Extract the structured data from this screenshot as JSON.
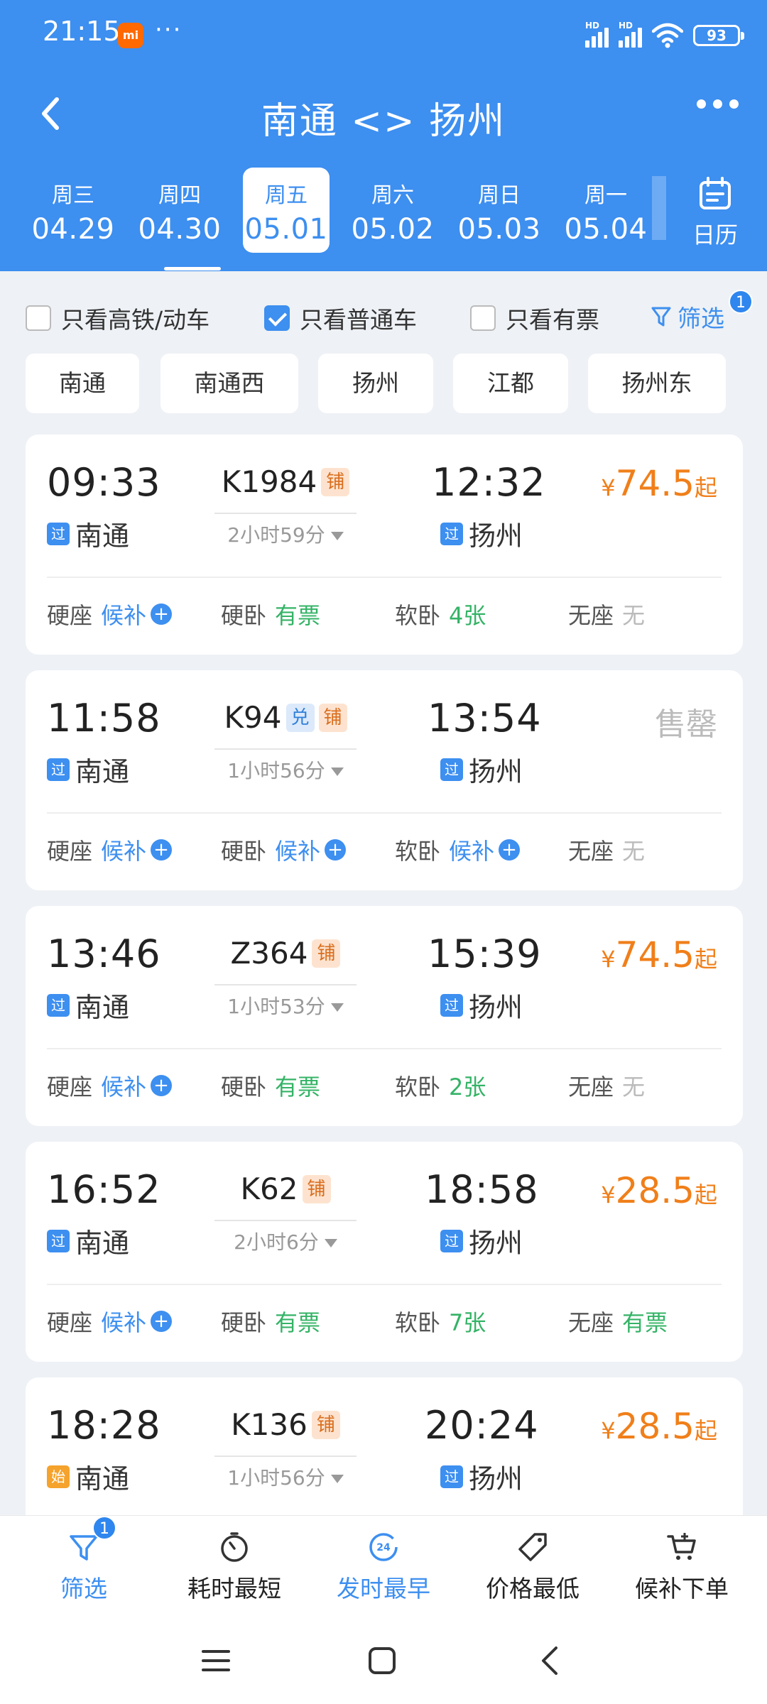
{
  "status": {
    "time": "21:15",
    "mi": "mi",
    "dots": "···",
    "battery": "93",
    "hd": "HD"
  },
  "nav": {
    "title": "南通 <> 扬州"
  },
  "dates": [
    {
      "weekday": "周三",
      "date": "04.29"
    },
    {
      "weekday": "周四",
      "date": "04.30"
    },
    {
      "weekday": "周五",
      "date": "05.01"
    },
    {
      "weekday": "周六",
      "date": "05.02"
    },
    {
      "weekday": "周日",
      "date": "05.03"
    },
    {
      "weekday": "周一",
      "date": "05.04"
    }
  ],
  "calendar_label": "日历",
  "filters": {
    "hsr_only": "只看高铁/动车",
    "normal_only": "只看普通车",
    "available_only": "只看有票",
    "filter_label": "筛选",
    "filter_badge": "1"
  },
  "stations": [
    "南通",
    "南通西",
    "扬州",
    "江都",
    "扬州东"
  ],
  "trains": [
    {
      "dep": "09:33",
      "from_tag": "过",
      "from": "南通",
      "no": "K1984",
      "badges": [
        "铺"
      ],
      "dur": "2小时59分",
      "arr": "12:32",
      "to_tag": "过",
      "to": "扬州",
      "price_sym": "¥",
      "price": "74.5",
      "price_suffix": "起",
      "seats": [
        {
          "name": "硬座",
          "val": "候补",
          "plus": "+"
        },
        {
          "name": "硬卧",
          "val": "有票"
        },
        {
          "name": "软卧",
          "val": "4张"
        },
        {
          "name": "无座",
          "val": "无"
        }
      ]
    },
    {
      "dep": "11:58",
      "from_tag": "过",
      "from": "南通",
      "no": "K94",
      "badges": [
        "兑",
        "铺"
      ],
      "dur": "1小时56分",
      "arr": "13:54",
      "to_tag": "过",
      "to": "扬州",
      "sold_out": "售罄",
      "seats": [
        {
          "name": "硬座",
          "val": "候补",
          "plus": "+"
        },
        {
          "name": "硬卧",
          "val": "候补",
          "plus": "+"
        },
        {
          "name": "软卧",
          "val": "候补",
          "plus": "+"
        },
        {
          "name": "无座",
          "val": "无"
        }
      ]
    },
    {
      "dep": "13:46",
      "from_tag": "过",
      "from": "南通",
      "no": "Z364",
      "badges": [
        "铺"
      ],
      "dur": "1小时53分",
      "arr": "15:39",
      "to_tag": "过",
      "to": "扬州",
      "price_sym": "¥",
      "price": "74.5",
      "price_suffix": "起",
      "seats": [
        {
          "name": "硬座",
          "val": "候补",
          "plus": "+"
        },
        {
          "name": "硬卧",
          "val": "有票"
        },
        {
          "name": "软卧",
          "val": "2张"
        },
        {
          "name": "无座",
          "val": "无"
        }
      ]
    },
    {
      "dep": "16:52",
      "from_tag": "过",
      "from": "南通",
      "no": "K62",
      "badges": [
        "铺"
      ],
      "dur": "2小时6分",
      "arr": "18:58",
      "to_tag": "过",
      "to": "扬州",
      "price_sym": "¥",
      "price": "28.5",
      "price_suffix": "起",
      "seats": [
        {
          "name": "硬座",
          "val": "候补",
          "plus": "+"
        },
        {
          "name": "硬卧",
          "val": "有票"
        },
        {
          "name": "软卧",
          "val": "7张"
        },
        {
          "name": "无座",
          "val": "有票"
        }
      ]
    },
    {
      "dep": "18:28",
      "from_tag": "始",
      "from": "南通",
      "no": "K136",
      "badges": [
        "铺"
      ],
      "dur": "1小时56分",
      "arr": "20:24",
      "to_tag": "过",
      "to": "扬州",
      "price_sym": "¥",
      "price": "28.5",
      "price_suffix": "起"
    }
  ],
  "tabs": [
    {
      "label": "筛选",
      "badge": "1"
    },
    {
      "label": "耗时最短"
    },
    {
      "label": "发时最早",
      "icon_text": "24"
    },
    {
      "label": "价格最低"
    },
    {
      "label": "候补下单"
    }
  ],
  "colors": {
    "primary": "#3d8ff0",
    "price": "#f07f1a",
    "green": "#34b366",
    "gray": "#bbbbbb"
  }
}
